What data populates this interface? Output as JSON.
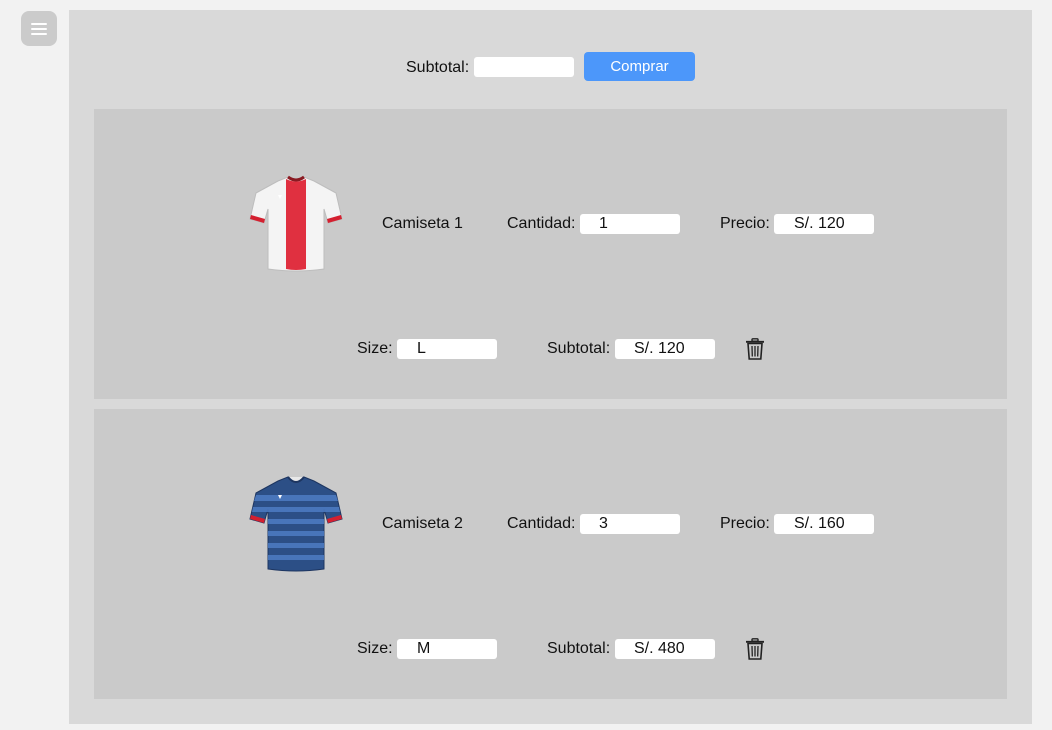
{
  "topbar": {
    "subtotal_label": "Subtotal:",
    "subtotal_value": "",
    "buy_label": "Comprar"
  },
  "items": [
    {
      "name": "Camiseta 1",
      "quantity_label": "Cantidad:",
      "quantity": "1",
      "price_label": "Precio:",
      "price": "S/. 120",
      "size_label": "Size:",
      "size": "L",
      "subtotal_label": "Subtotal:",
      "subtotal": "S/. 120",
      "image_icon": "jersey-red-white-icon"
    },
    {
      "name": "Camiseta 2",
      "quantity_label": "Cantidad:",
      "quantity": "3",
      "price_label": "Precio:",
      "price": "S/. 160",
      "size_label": "Size:",
      "size": "M",
      "subtotal_label": "Subtotal:",
      "subtotal": "S/. 480",
      "image_icon": "jersey-blue-stripes-icon"
    }
  ],
  "icons": {
    "menu": "hamburger-menu-icon",
    "delete": "trash-icon"
  },
  "colors": {
    "buy_button": "#4c97fa",
    "panel": "#d9d9d9",
    "card": "#cacaca"
  }
}
